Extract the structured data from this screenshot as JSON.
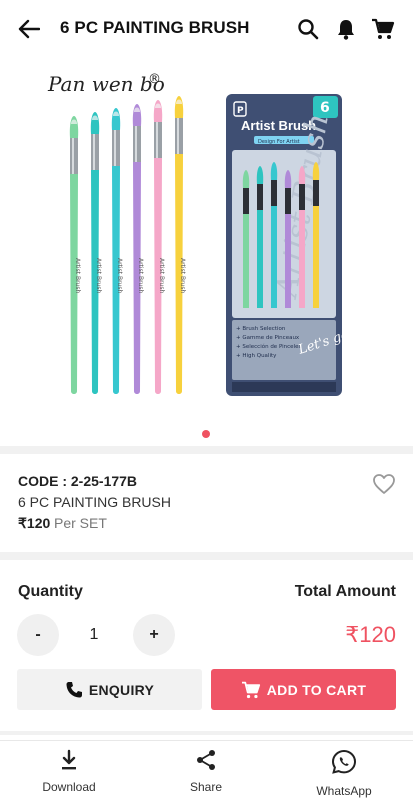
{
  "appbar": {
    "title": "6 PC PAINTING BRUSH",
    "icons": [
      "back-arrow-icon",
      "search-icon",
      "bell-icon",
      "cart-icon"
    ]
  },
  "gallery": {
    "brand_text": "Pan wen bo",
    "pack_title": "Artist Brush",
    "pack_count": "6",
    "pack_tagline": "Design For Artist",
    "pack_features": [
      "Brush Selection",
      "Gamme de Pinceaux",
      "Selección de Pinceles",
      "High Quality"
    ],
    "pack_slogan": "Let's go!",
    "brush_label": "Artist Brush",
    "brush_colors": [
      "#7ed6a0",
      "#2ec4c0",
      "#37c7cf",
      "#b08ad8",
      "#f5a7c8",
      "#f7d13d"
    ],
    "active_dot": 1
  },
  "product": {
    "code": "CODE : 2-25-177B",
    "name": "6 PC PAINTING BRUSH",
    "price": "₹120",
    "unit": "Per SET"
  },
  "order": {
    "quantity_label": "Quantity",
    "total_label": "Total Amount",
    "minus": "-",
    "plus": "+",
    "quantity": "1",
    "total": "₹120"
  },
  "actions": {
    "enquiry": "ENQUIRY",
    "add_to_cart": "ADD TO CART"
  },
  "bottom_nav": {
    "download": "Download",
    "share": "Share",
    "whatsapp": "WhatsApp"
  },
  "colors": {
    "accent": "#ef5466",
    "dot": "#ef5261",
    "package_blue": "#3f4f73"
  }
}
